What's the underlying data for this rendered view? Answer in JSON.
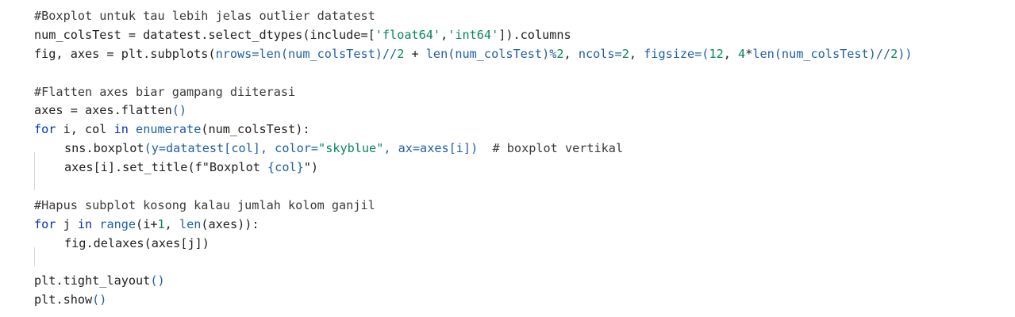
{
  "editor": {
    "lines": [
      [
        {
          "t": "#Boxplot untuk tau lebih jelas outlier datatest",
          "c": "comment"
        }
      ],
      [
        {
          "t": "num_colsTest = datatest.select_dtypes(include=[",
          "c": "ident"
        },
        {
          "t": "'float64'",
          "c": "str"
        },
        {
          "t": ",",
          "c": "ident"
        },
        {
          "t": "'int64'",
          "c": "str"
        },
        {
          "t": "]).columns",
          "c": "ident"
        }
      ],
      [
        {
          "t": "fig, axes = plt.subplots(",
          "c": "ident"
        },
        {
          "t": "nrows=len(num_colsTest)//",
          "c": "call"
        },
        {
          "t": "2",
          "c": "num"
        },
        {
          "t": " + ",
          "c": "ident"
        },
        {
          "t": "len(num_colsTest)%",
          "c": "call"
        },
        {
          "t": "2",
          "c": "num"
        },
        {
          "t": ", ",
          "c": "ident"
        },
        {
          "t": "ncols=",
          "c": "call"
        },
        {
          "t": "2",
          "c": "num"
        },
        {
          "t": ", ",
          "c": "ident"
        },
        {
          "t": "figsize=(",
          "c": "call"
        },
        {
          "t": "12",
          "c": "num"
        },
        {
          "t": ", ",
          "c": "ident"
        },
        {
          "t": "4",
          "c": "num"
        },
        {
          "t": "*",
          "c": "ident"
        },
        {
          "t": "len(num_colsTest)//",
          "c": "call"
        },
        {
          "t": "2",
          "c": "num"
        },
        {
          "t": "))",
          "c": "bracket"
        }
      ],
      [],
      [
        {
          "t": "#Flatten axes biar gampang diiterasi",
          "c": "comment"
        }
      ],
      [
        {
          "t": "axes = axes.flatten",
          "c": "ident"
        },
        {
          "t": "()",
          "c": "bracket"
        }
      ],
      [
        {
          "t": "for",
          "c": "kw"
        },
        {
          "t": " i, col ",
          "c": "ident"
        },
        {
          "t": "in",
          "c": "kw"
        },
        {
          "t": " ",
          "c": "ident"
        },
        {
          "t": "enumerate",
          "c": "call"
        },
        {
          "t": "(num_colsTest):",
          "c": "ident"
        }
      ],
      {
        "indent": 1,
        "tokens": [
          {
            "t": "sns.boxplot",
            "c": "ident"
          },
          {
            "t": "(y=datatest[col], color=",
            "c": "call"
          },
          {
            "t": "\"skyblue\"",
            "c": "str"
          },
          {
            "t": ", ax=axes[i])",
            "c": "call"
          },
          {
            "t": "  # boxplot vertikal",
            "c": "comment"
          }
        ]
      },
      {
        "indent": 1,
        "tokens": [
          {
            "t": "axes[i].set_title(f\"Boxplot ",
            "c": "ident"
          },
          {
            "t": "{col}",
            "c": "call"
          },
          {
            "t": "\")",
            "c": "ident"
          }
        ]
      },
      [],
      [
        {
          "t": "#Hapus subplot kosong kalau jumlah kolom ganjil",
          "c": "comment"
        }
      ],
      [
        {
          "t": "for",
          "c": "kw"
        },
        {
          "t": " j ",
          "c": "ident"
        },
        {
          "t": "in",
          "c": "kw"
        },
        {
          "t": " ",
          "c": "ident"
        },
        {
          "t": "range",
          "c": "call"
        },
        {
          "t": "(i+",
          "c": "ident"
        },
        {
          "t": "1",
          "c": "num"
        },
        {
          "t": ", ",
          "c": "ident"
        },
        {
          "t": "len",
          "c": "call"
        },
        {
          "t": "(axes)):",
          "c": "ident"
        }
      ],
      {
        "indent": 1,
        "tokens": [
          {
            "t": "fig.delaxes(axes[j])",
            "c": "ident"
          }
        ]
      },
      [],
      [
        {
          "t": "plt.tight_layout",
          "c": "ident"
        },
        {
          "t": "()",
          "c": "bracket"
        }
      ],
      [
        {
          "t": "plt.show",
          "c": "ident"
        },
        {
          "t": "()",
          "c": "bracket"
        }
      ]
    ]
  }
}
